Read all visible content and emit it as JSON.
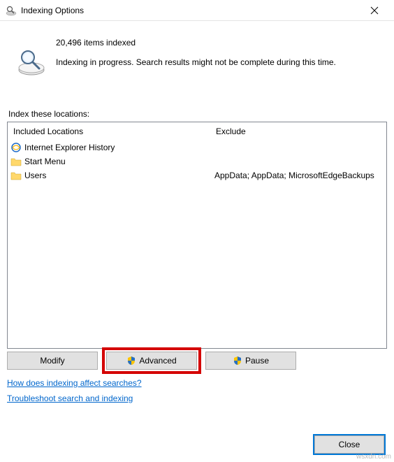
{
  "window": {
    "title": "Indexing Options"
  },
  "status": {
    "count_line": "20,496 items indexed",
    "progress_line": "Indexing in progress. Search results might not be complete during this time."
  },
  "section_label": "Index these locations:",
  "columns": {
    "included_header": "Included Locations",
    "exclude_header": "Exclude"
  },
  "locations": [
    {
      "icon": "ie",
      "name": "Internet Explorer History",
      "exclude": ""
    },
    {
      "icon": "folder",
      "name": "Start Menu",
      "exclude": ""
    },
    {
      "icon": "folder",
      "name": "Users",
      "exclude": "AppData; AppData; MicrosoftEdgeBackups"
    }
  ],
  "buttons": {
    "modify": "Modify",
    "advanced": "Advanced",
    "pause": "Pause",
    "close": "Close"
  },
  "links": {
    "how": "How does indexing affect searches?",
    "troubleshoot": "Troubleshoot search and indexing"
  },
  "watermark": "wsxdn.com"
}
